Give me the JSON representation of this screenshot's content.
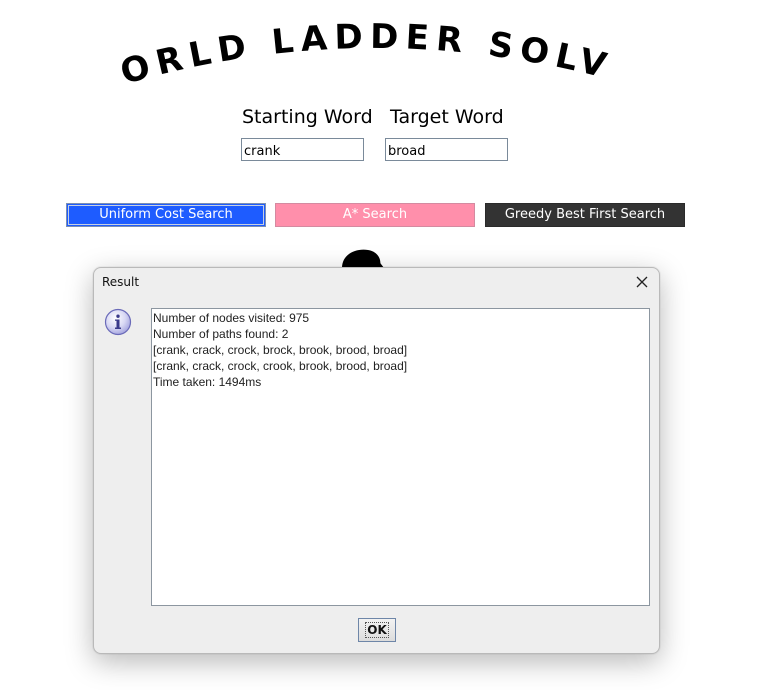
{
  "app": {
    "title": "WORLD LADDER SOLVER"
  },
  "form": {
    "starting_word_label": "Starting Word",
    "target_word_label": "Target Word",
    "starting_word_value": "crank",
    "target_word_value": "broad"
  },
  "buttons": {
    "ucs_label": "Uniform Cost Search",
    "astar_label": "A* Search",
    "greedy_label": "Greedy Best First Search"
  },
  "colors": {
    "ucs_bg": "#1e5cff",
    "astar_bg": "#ff8fab",
    "greedy_bg": "#333333"
  },
  "dialog": {
    "title": "Result",
    "icon": "info-icon",
    "lines": [
      "Number of nodes visited: 975",
      "Number of paths found: 2",
      "[crank, crack, crock, brock, brook, brood, broad]",
      "[crank, crack, crock, crook, brook, brood, broad]",
      "Time taken: 1494ms"
    ],
    "ok_label": "OK"
  }
}
